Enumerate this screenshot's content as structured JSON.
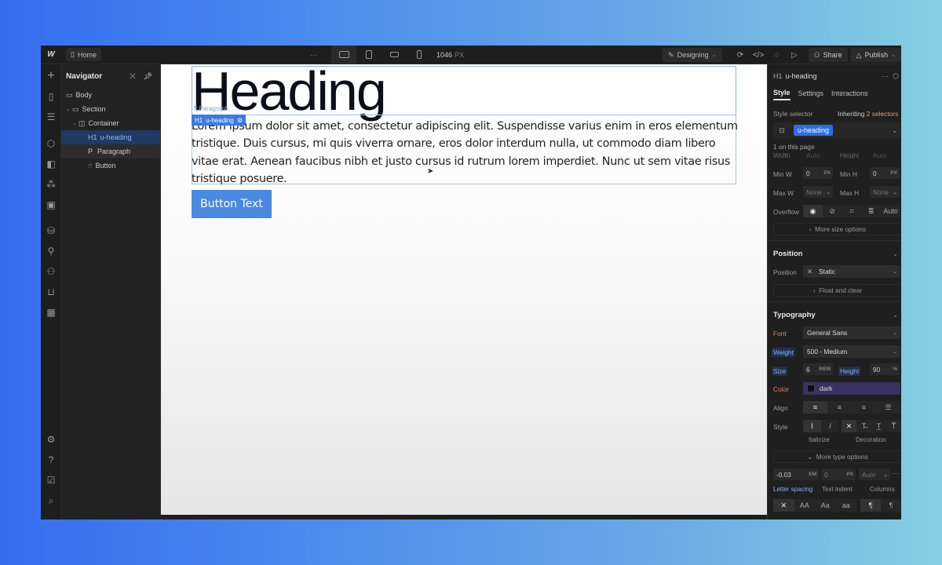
{
  "topbar": {
    "logo": "W",
    "home_label": "Home",
    "overflow": "···",
    "breakpoint_width": "1046",
    "breakpoint_unit": "PX",
    "mode_label": "Designing",
    "share_label": "Share",
    "publish_label": "Publish"
  },
  "navigator": {
    "title": "Navigator",
    "items": [
      {
        "label": "Body",
        "type_icon": "body"
      },
      {
        "label": "Section",
        "type_icon": "section"
      },
      {
        "label": "Container",
        "type_icon": "container"
      },
      {
        "label": "u-heading",
        "prefix": "H1"
      },
      {
        "label": "Paragraph",
        "prefix": "P"
      },
      {
        "label": "Button",
        "type_icon": "hand"
      }
    ]
  },
  "canvas": {
    "heading": "Heading",
    "paragraph": "Lorem ipsum dolor sit amet, consectetur adipiscing elit. Suspendisse varius enim in eros elementum tristique. Duis cursus, mi quis viverra ornare, eros dolor interdum nulla, ut commodo diam libero vitae erat. Aenean faucibus nibh et justo cursus id rutrum lorem imperdiet. Nunc ut sem vitae risus tristique posuere.",
    "paragraph_tag": "Paragraph",
    "selected_tag_type": "H1",
    "selected_tag_class": "u-heading",
    "button_text": "Button Text"
  },
  "panel": {
    "selected_type": "H1",
    "selected_class": "u-heading",
    "tabs": [
      "Style",
      "Settings",
      "Interactions"
    ],
    "style_selector_label": "Style selector",
    "inheriting_label": "Inheriting",
    "inheriting_count": "2 selectors",
    "selector_chip": "u-heading",
    "on_page": "1 on this page",
    "size": {
      "width_label": "Width",
      "width_value": "Auto",
      "height_label": "Height",
      "height_value": "Auto",
      "min_w_label": "Min W",
      "min_w_value": "0",
      "min_w_unit": "PX",
      "min_h_label": "Min H",
      "min_h_value": "0",
      "min_h_unit": "PX",
      "max_w_label": "Max W",
      "max_w_value": "None",
      "max_h_label": "Max H",
      "max_h_value": "None",
      "overflow_label": "Overflow",
      "overflow_auto": "Auto",
      "more_label": "More size options"
    },
    "position": {
      "title": "Position",
      "label": "Position",
      "value": "Static",
      "float_label": "Float and clear"
    },
    "typography": {
      "title": "Typography",
      "font_label": "Font",
      "font_value": "General Sans",
      "weight_label": "Weight",
      "weight_value": "500 - Medium",
      "size_label": "Size",
      "size_value": "6",
      "size_unit": "REM",
      "height_label": "Height",
      "height_value": "90",
      "height_unit": "%",
      "color_label": "Color",
      "color_value": "dark",
      "color_hex": "#0b0f1a",
      "align_label": "Align",
      "style_label": "Style",
      "italicize_label": "Italicize",
      "decoration_label": "Decoration",
      "more_label": "More type options",
      "letter_spacing_value": "-0.03",
      "letter_spacing_unit": "EM",
      "text_indent_value": "0",
      "text_indent_unit": "PX",
      "columns_value": "Auto",
      "letter_spacing_label": "Letter spacing",
      "text_indent_label": "Text indent",
      "columns_label": "Columns",
      "case_options": [
        "AA",
        "Aa",
        "aa"
      ]
    }
  },
  "colors": {
    "accent": "#3b7ae0",
    "button": "#4a89e0",
    "panel_bg": "#1f1f1f"
  }
}
